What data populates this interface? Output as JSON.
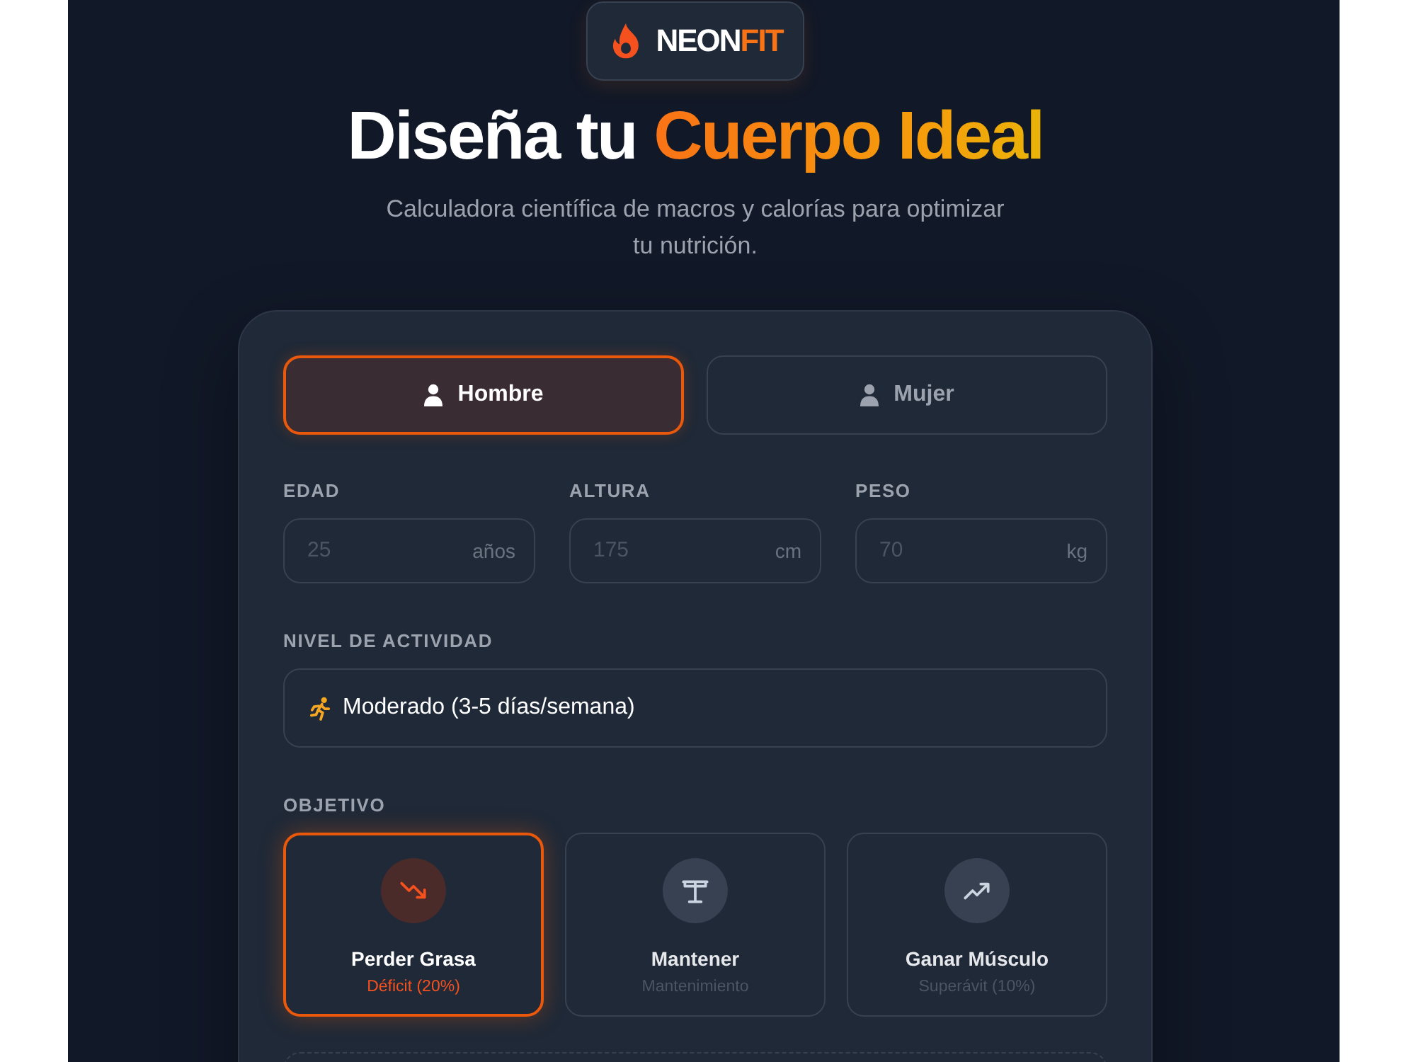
{
  "logo": {
    "name": "NEON",
    "accent": "FIT"
  },
  "headline": {
    "text": "Diseña tu",
    "highlight": "Cuerpo Ideal"
  },
  "subtitle": "Calculadora científica de macros y calorías para optimizar tu nutrición.",
  "gender": [
    {
      "label": "Hombre",
      "selected": true
    },
    {
      "label": "Mujer",
      "selected": false
    }
  ],
  "measurements": [
    {
      "label": "EDAD",
      "placeholder": "25",
      "unit": "años"
    },
    {
      "label": "ALTURA",
      "placeholder": "175",
      "unit": "cm"
    },
    {
      "label": "PESO",
      "placeholder": "70",
      "unit": "kg"
    }
  ],
  "activity": {
    "label": "NIVEL DE ACTIVIDAD",
    "value": "Moderado (3-5 días/semana)"
  },
  "goal": {
    "label": "OBJETIVO",
    "options": [
      {
        "kind": "trend-down",
        "title": "Perder Grasa",
        "subtitle": "Déficit (20%)",
        "selected": true
      },
      {
        "kind": "balance",
        "title": "Mantener",
        "subtitle": "Mantenimiento",
        "selected": false
      },
      {
        "kind": "trend-up",
        "title": "Ganar Músculo",
        "subtitle": "Superávit (10%)",
        "selected": false
      }
    ]
  }
}
